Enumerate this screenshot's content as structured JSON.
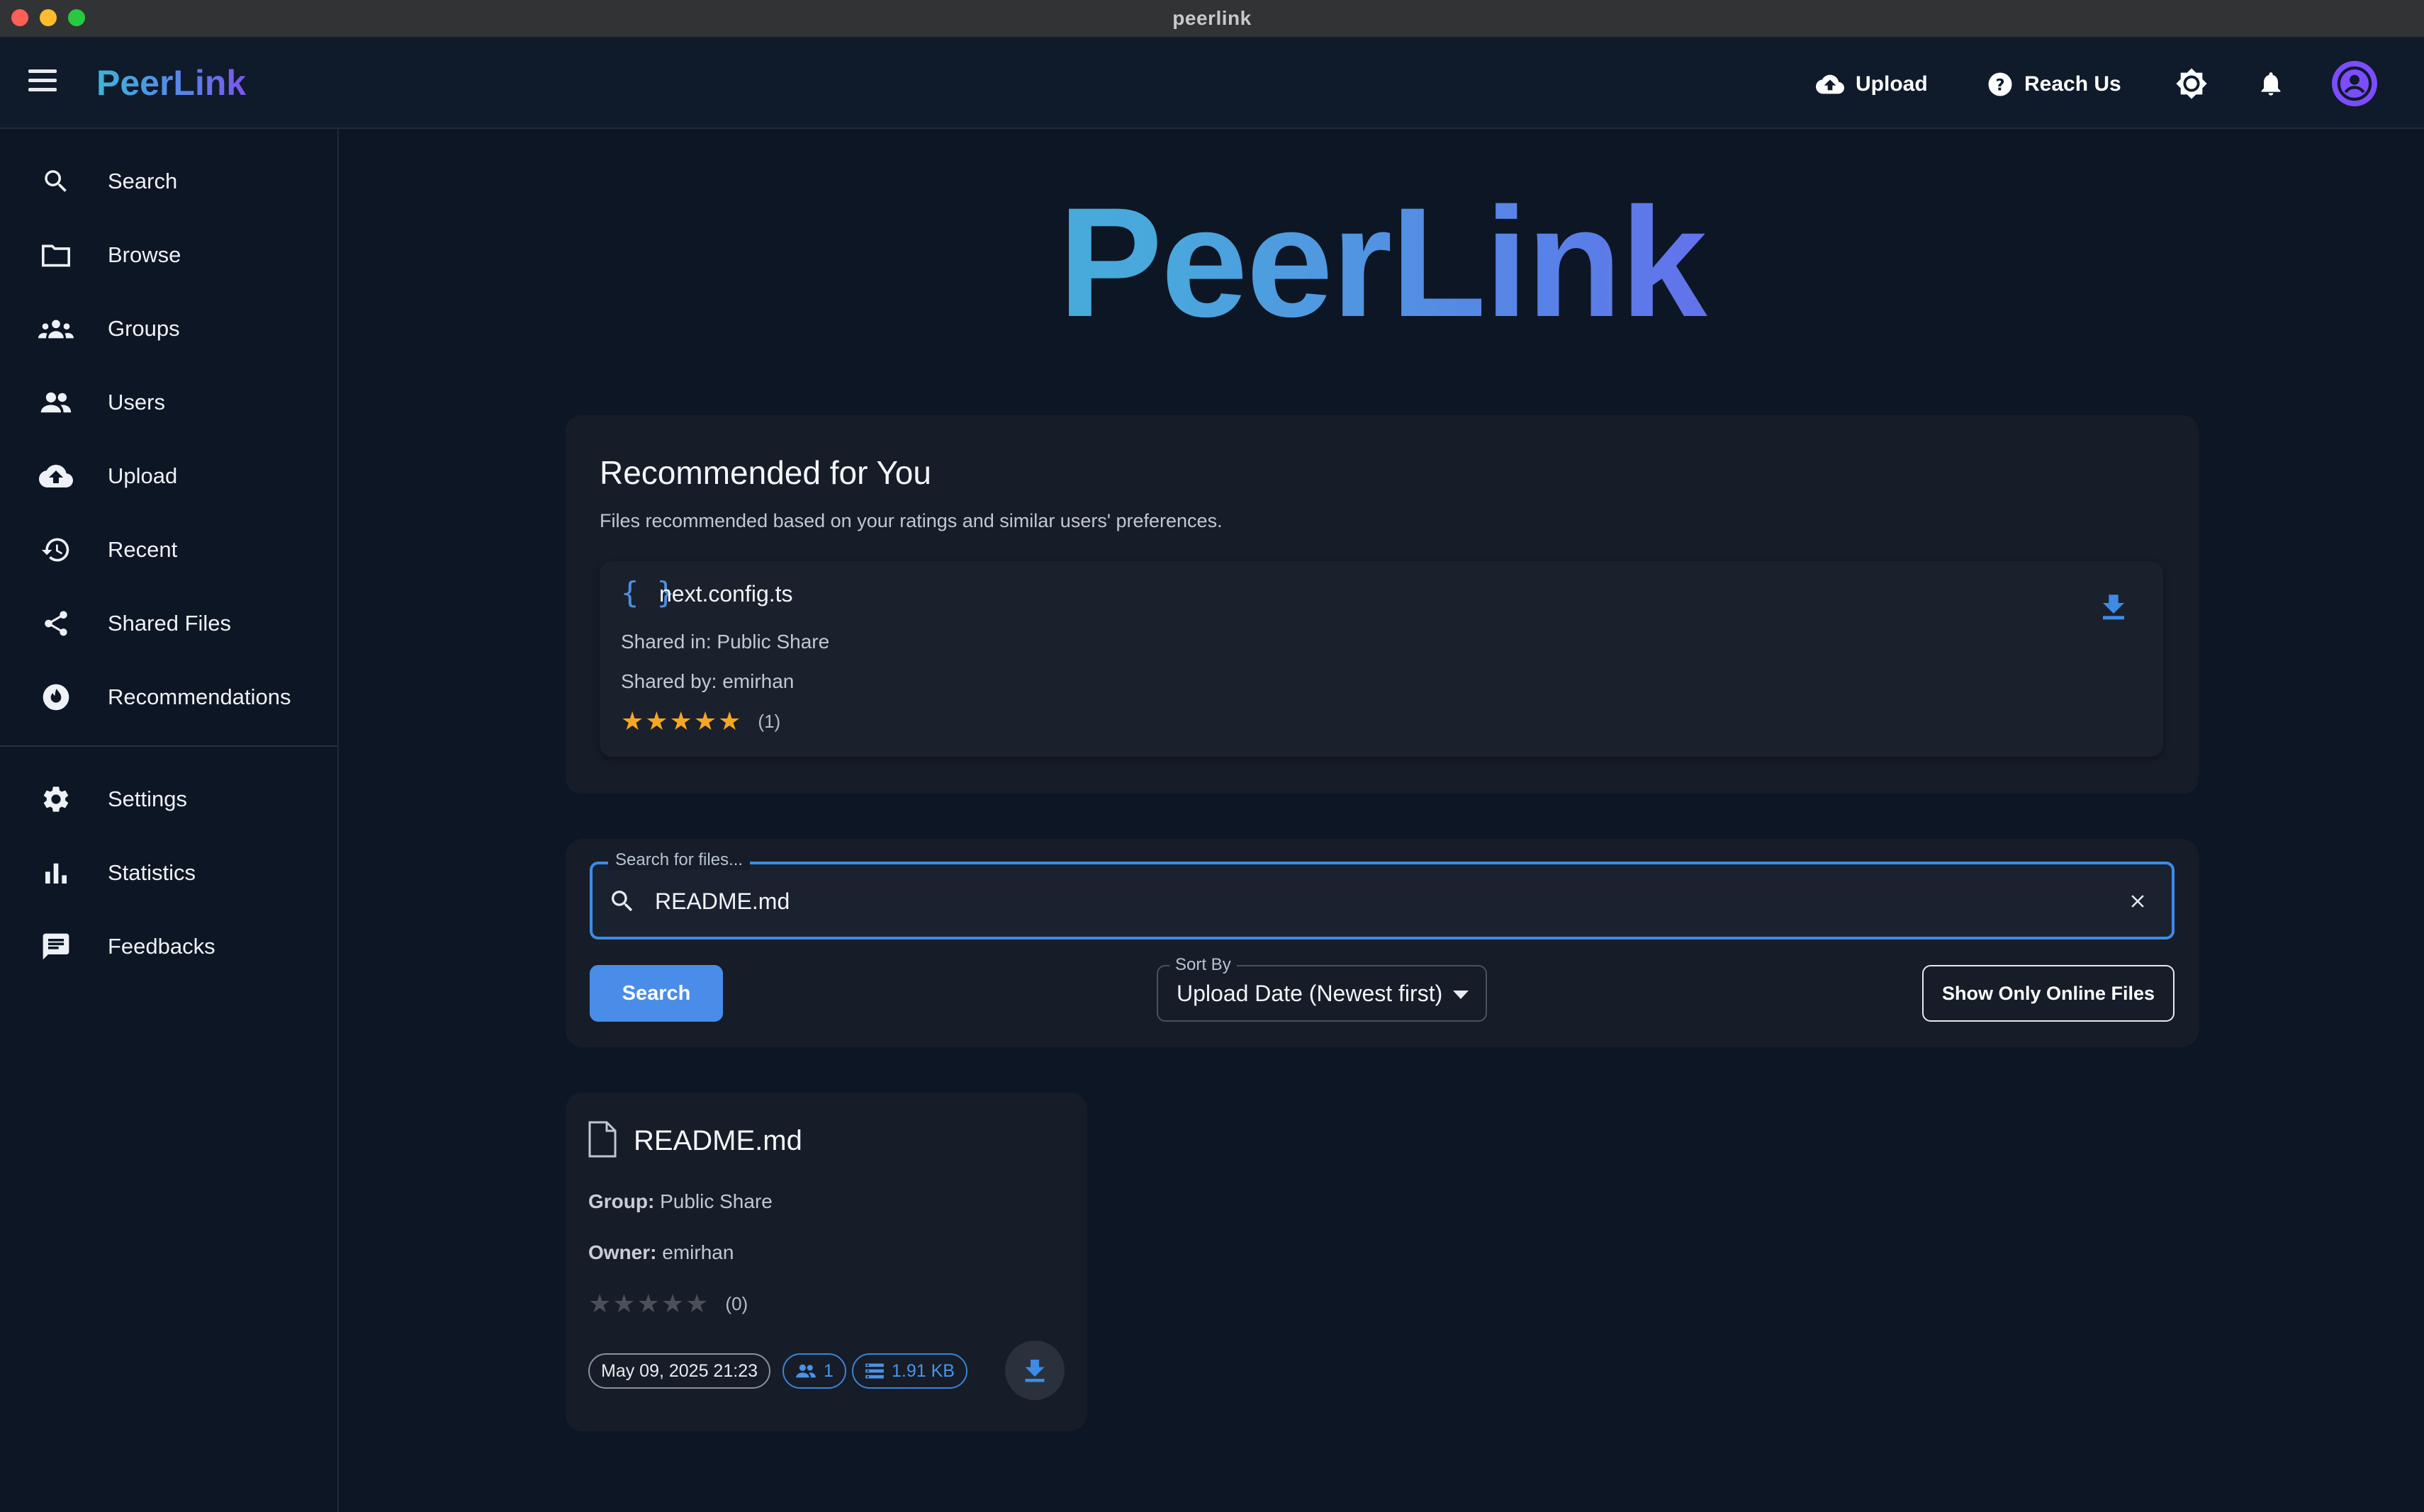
{
  "window": {
    "title": "peerlink"
  },
  "appbar": {
    "brand": "PeerLink",
    "upload_label": "Upload",
    "reach_label": "Reach Us"
  },
  "sidebar": {
    "items": [
      {
        "label": "Search",
        "icon": "search-icon"
      },
      {
        "label": "Browse",
        "icon": "folder-icon"
      },
      {
        "label": "Groups",
        "icon": "groups-icon"
      },
      {
        "label": "Users",
        "icon": "users-icon"
      },
      {
        "label": "Upload",
        "icon": "cloud-upload-icon"
      },
      {
        "label": "Recent",
        "icon": "history-icon"
      },
      {
        "label": "Shared Files",
        "icon": "share-icon"
      },
      {
        "label": "Recommendations",
        "icon": "recommendations-icon"
      }
    ],
    "secondary": [
      {
        "label": "Settings",
        "icon": "gear-icon"
      },
      {
        "label": "Statistics",
        "icon": "bar-chart-icon"
      },
      {
        "label": "Feedbacks",
        "icon": "feedback-icon"
      }
    ]
  },
  "hero": {
    "title": "PeerLink"
  },
  "recommended": {
    "title": "Recommended for You",
    "subtitle": "Files recommended based on your ratings and similar users' preferences.",
    "item": {
      "name": "next.config.ts",
      "shared_in": "Shared in: Public Share",
      "shared_by": "Shared by: emirhan",
      "rating": 5,
      "rating_count": "(1)"
    }
  },
  "search": {
    "label": "Search for files...",
    "value": "README.md",
    "button_label": "Search",
    "sort_label": "Sort By",
    "sort_value": "Upload Date (Newest first)",
    "online_label": "Show Only Online Files"
  },
  "result": {
    "name": "README.md",
    "group_label": "Group:",
    "group_value": "Public Share",
    "owner_label": "Owner:",
    "owner_value": "emirhan",
    "rating": 0,
    "rating_count": "(0)",
    "date": "May 09, 2025 21:23",
    "peers": "1",
    "size": "1.91 KB"
  },
  "colors": {
    "accent_blue": "#4a8de8",
    "star_gold": "#f5a623",
    "avatar_purple": "#7c4dff"
  }
}
